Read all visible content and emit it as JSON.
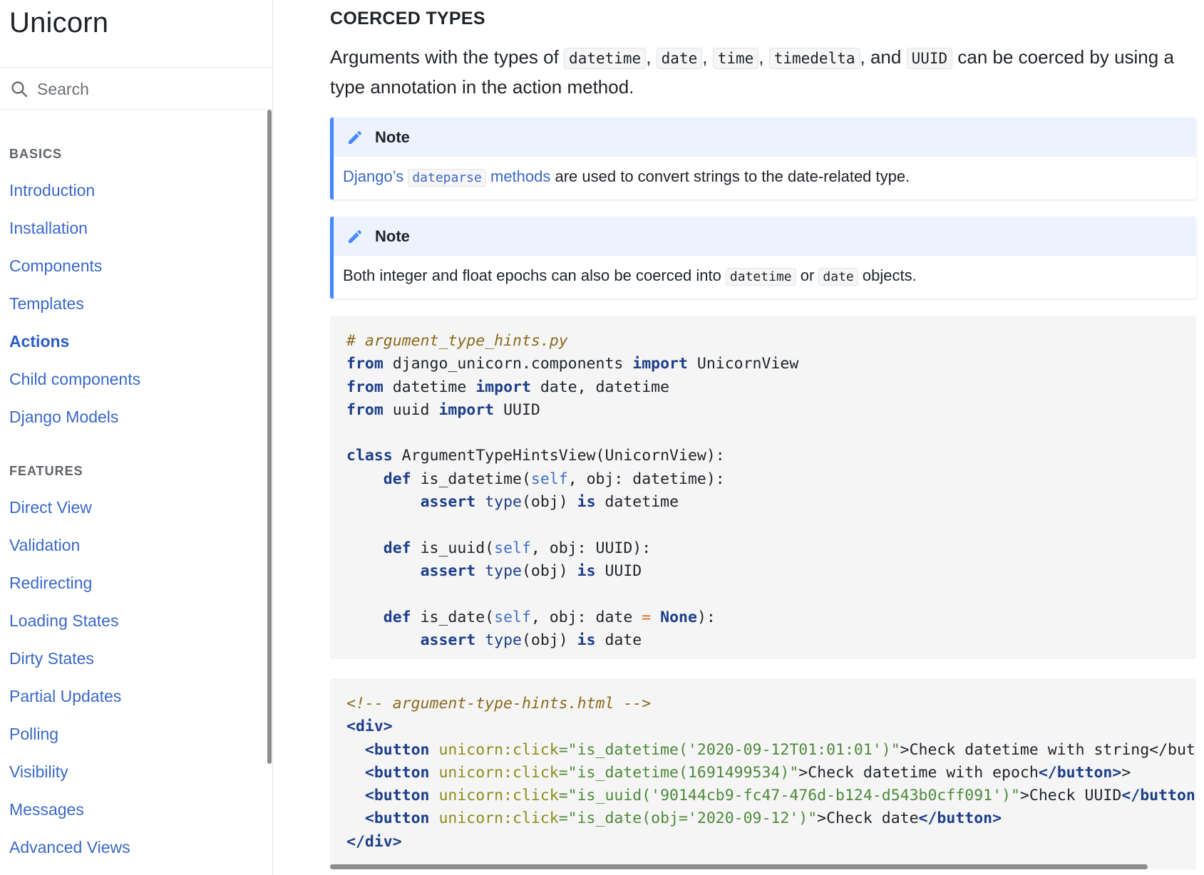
{
  "brand": "Unicorn",
  "search": {
    "placeholder": "Search"
  },
  "nav": {
    "basics_title": "BASICS",
    "basics": [
      "Introduction",
      "Installation",
      "Components",
      "Templates",
      "Actions",
      "Child components",
      "Django Models"
    ],
    "features_title": "FEATURES",
    "features": [
      "Direct View",
      "Validation",
      "Redirecting",
      "Loading States",
      "Dirty States",
      "Partial Updates",
      "Polling",
      "Visibility",
      "Messages",
      "Advanced Views"
    ],
    "active": "Actions"
  },
  "content": {
    "heading": "COERCED TYPES",
    "para": {
      "p1": "Arguments with the types of ",
      "c1": "datetime",
      "sep1": ", ",
      "c2": "date",
      "sep2": ", ",
      "c3": "time",
      "sep3": ", ",
      "c4": "timedelta",
      "sep4": ", and ",
      "c5": "UUID",
      "p2": " can be coerced by using a type annotation in the action method."
    },
    "note1": {
      "title": "Note",
      "link_text1": "Django’s ",
      "link_code": "dateparse",
      "link_text2": " methods",
      "rest": " are used to convert strings to the date-related type."
    },
    "note2": {
      "title": "Note",
      "t1": "Both integer and float epochs can also be coerced into ",
      "c1": "datetime",
      "t2": " or ",
      "c2": "date",
      "t3": " objects."
    },
    "code_py": {
      "comment": "# argument_type_hints.py",
      "l2_from": "from",
      "l2_mod": " django_unicorn.components ",
      "l2_import": "import",
      "l2_name": " UnicornView",
      "l3_from": "from",
      "l3_mod": " datetime ",
      "l3_import": "import",
      "l3_name": " date, datetime",
      "l4_from": "from",
      "l4_mod": " uuid ",
      "l4_import": "import",
      "l4_name": " UUID",
      "l6_class": "class",
      "l6_rest": " ArgumentTypeHintsView(UnicornView):",
      "def": "def",
      "self": "self",
      "assert": "assert",
      "type": "type",
      "is": "is",
      "none": "None",
      "eq": "=",
      "m1_name": " is_datetime(",
      "m1_args": ", obj: datetime):",
      "m1_tail": " datetime",
      "m2_name": " is_uuid(",
      "m2_args": ", obj: UUID):",
      "m2_tail": " UUID",
      "m3_name": " is_date(",
      "m3_args": ", obj: date ",
      "m3_end": "):",
      "m3_tail": " date",
      "obj": "(obj) "
    },
    "code_html": {
      "comment": "<!-- argument-type-hints.html -->",
      "div_open": "<div>",
      "div_close": "</div>",
      "b1_open": "<button",
      "attr": " unicorn:click",
      "b1_val": "=\"is_datetime('2020-09-12T01:01:01')\"",
      "b1_text": ">Check datetime with string</but",
      "b2_val": "=\"is_datetime(1691499534)\"",
      "b2_text": ">Check datetime with epoch",
      "b2_close": "</button>",
      "b3_val": "=\"is_uuid('90144cb9-fc47-476d-b124-d543b0cff091')\"",
      "b3_text": ">Check UUID",
      "b3_close": "</button:",
      "b4_val": "=\"is_date(obj='2020-09-12')\"",
      "b4_text": ">Check date",
      "b4_close": "</button>",
      "gt": ">"
    }
  },
  "colors": {
    "link": "#3a68c8",
    "admonition_border": "#448aff",
    "admonition_head": "#ecf3ff",
    "code_bg": "#f5f5f5"
  }
}
